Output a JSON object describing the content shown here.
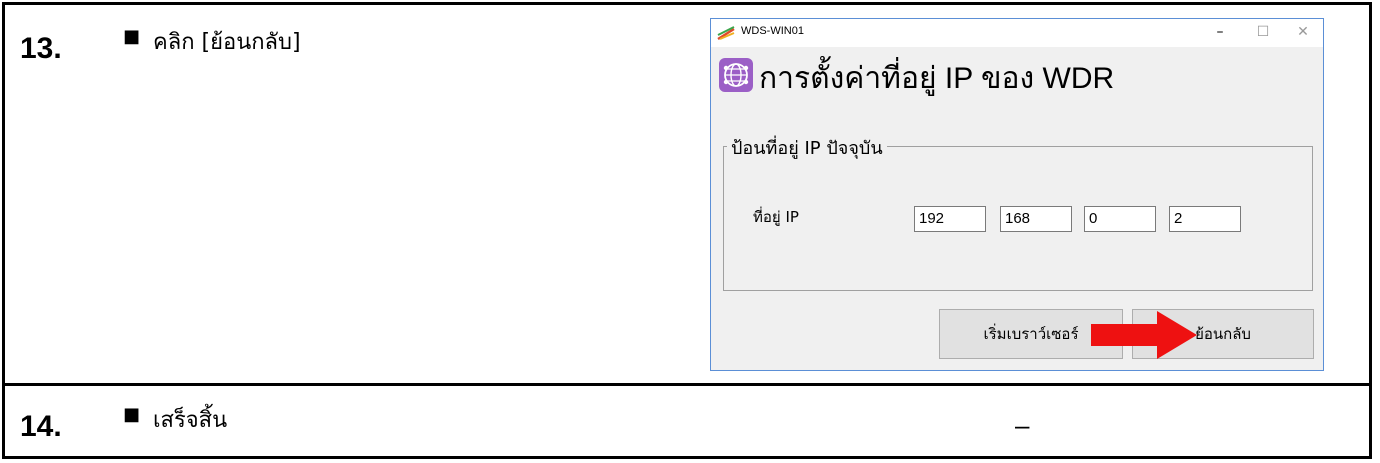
{
  "steps": [
    {
      "number": "13.",
      "bullet": "■",
      "text": "คลิก  [ย้อนกลับ]"
    },
    {
      "number": "14.",
      "bullet": "■",
      "text": "เสร็จสิ้น",
      "result": "–"
    }
  ],
  "window": {
    "title": "WDS-WIN01",
    "controls": {
      "minimize": "–",
      "maximize": "☐",
      "close": "✕"
    },
    "heading": "การตั้งค่าที่อยู่ IP ของ WDR",
    "group_label": "ป้อนที่อยู่ IP ปัจจุบัน",
    "ip_label": "ที่อยู่ IP",
    "ip_octets": [
      "192",
      "168",
      "0",
      "2"
    ],
    "buttons": {
      "browser": "เริ่มเบราว์เซอร์",
      "back": "ย้อนกลับ"
    },
    "icons": {
      "app": "wds-app-icon",
      "header": "network-globe-icon",
      "pointer": "red-arrow-icon"
    },
    "colors": {
      "arrow": "#ee1111",
      "header_icon": "#9b5fc6",
      "window_border": "#5b8fd6"
    }
  }
}
